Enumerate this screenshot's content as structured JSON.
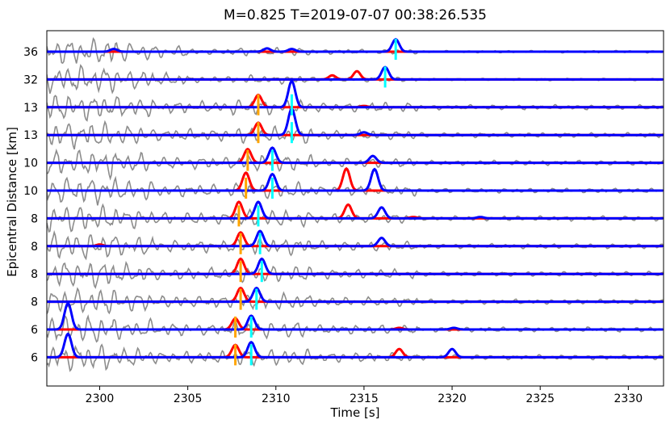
{
  "chart_data": {
    "type": "line",
    "title": "M=0.825  T=2019-07-07 00:38:26.535",
    "xlabel": "Time [s]",
    "ylabel": "Epicentral Distance [km]",
    "xlim": [
      2297,
      2332
    ],
    "xticks": [
      2300,
      2305,
      2310,
      2315,
      2320,
      2325,
      2330
    ],
    "colors": {
      "waveform": "#7f7f7f",
      "p_prob": "#ff0000",
      "s_prob": "#0000ff",
      "p_pick": "#ffa500",
      "s_pick": "#00ffff"
    },
    "traces": [
      {
        "distance": "36",
        "p_peaks": [],
        "s_peaks": [
          {
            "t": 2300.8,
            "a": 0.1
          },
          {
            "t": 2309.5,
            "a": 0.12
          },
          {
            "t": 2310.9,
            "a": 0.1
          },
          {
            "t": 2316.8,
            "a": 0.45
          }
        ],
        "p_pick": null,
        "s_pick": 2316.8
      },
      {
        "distance": "32",
        "p_peaks": [
          {
            "t": 2313.2,
            "a": 0.15
          },
          {
            "t": 2314.6,
            "a": 0.3
          }
        ],
        "s_peaks": [
          {
            "t": 2316.2,
            "a": 0.45
          }
        ],
        "p_pick": null,
        "s_pick": 2316.2
      },
      {
        "distance": "13",
        "p_peaks": [
          {
            "t": 2309.0,
            "a": 0.45
          },
          {
            "t": 2315.0,
            "a": 0.05
          }
        ],
        "s_peaks": [
          {
            "t": 2310.9,
            "a": 0.95
          }
        ],
        "p_pick": 2309.0,
        "s_pick": 2310.9
      },
      {
        "distance": "13",
        "p_peaks": [
          {
            "t": 2309.0,
            "a": 0.45
          }
        ],
        "s_peaks": [
          {
            "t": 2310.9,
            "a": 0.95
          },
          {
            "t": 2315.0,
            "a": 0.1
          }
        ],
        "p_pick": 2309.0,
        "s_pick": 2310.9
      },
      {
        "distance": "10",
        "p_peaks": [
          {
            "t": 2308.4,
            "a": 0.5
          }
        ],
        "s_peaks": [
          {
            "t": 2309.8,
            "a": 0.55
          },
          {
            "t": 2315.5,
            "a": 0.25
          }
        ],
        "p_pick": 2308.4,
        "s_pick": 2309.8
      },
      {
        "distance": "10",
        "p_peaks": [
          {
            "t": 2308.3,
            "a": 0.65
          },
          {
            "t": 2314.0,
            "a": 0.8
          }
        ],
        "s_peaks": [
          {
            "t": 2309.8,
            "a": 0.6
          },
          {
            "t": 2315.6,
            "a": 0.78
          }
        ],
        "p_pick": 2308.3,
        "s_pick": 2309.8
      },
      {
        "distance": "8",
        "p_peaks": [
          {
            "t": 2307.9,
            "a": 0.6
          },
          {
            "t": 2314.1,
            "a": 0.5
          },
          {
            "t": 2317.8,
            "a": 0.05
          }
        ],
        "s_peaks": [
          {
            "t": 2309.0,
            "a": 0.6
          },
          {
            "t": 2316.0,
            "a": 0.4
          },
          {
            "t": 2321.6,
            "a": 0.05
          }
        ],
        "p_pick": 2307.9,
        "s_pick": 2309.0
      },
      {
        "distance": "8",
        "p_peaks": [
          {
            "t": 2300.0,
            "a": 0.06
          },
          {
            "t": 2308.0,
            "a": 0.5
          }
        ],
        "s_peaks": [
          {
            "t": 2309.1,
            "a": 0.55
          },
          {
            "t": 2316.0,
            "a": 0.3
          }
        ],
        "p_pick": 2308.0,
        "s_pick": 2309.1
      },
      {
        "distance": "8",
        "p_peaks": [
          {
            "t": 2308.0,
            "a": 0.55
          }
        ],
        "s_peaks": [
          {
            "t": 2309.2,
            "a": 0.55
          }
        ],
        "p_pick": 2308.0,
        "s_pick": 2309.2
      },
      {
        "distance": "8",
        "p_peaks": [
          {
            "t": 2308.0,
            "a": 0.5
          }
        ],
        "s_peaks": [
          {
            "t": 2308.9,
            "a": 0.5
          }
        ],
        "p_pick": 2308.0,
        "s_pick": 2308.9
      },
      {
        "distance": "6",
        "p_peaks": [
          {
            "t": 2307.7,
            "a": 0.4
          },
          {
            "t": 2317.0,
            "a": 0.06
          }
        ],
        "s_peaks": [
          {
            "t": 2298.2,
            "a": 0.95
          },
          {
            "t": 2308.6,
            "a": 0.5
          },
          {
            "t": 2320.1,
            "a": 0.06
          }
        ],
        "p_pick": 2307.7,
        "s_pick": 2308.6
      },
      {
        "distance": "6",
        "p_peaks": [
          {
            "t": 2307.7,
            "a": 0.45
          },
          {
            "t": 2317.0,
            "a": 0.3
          }
        ],
        "s_peaks": [
          {
            "t": 2298.2,
            "a": 0.85
          },
          {
            "t": 2308.6,
            "a": 0.55
          },
          {
            "t": 2320.0,
            "a": 0.3
          }
        ],
        "p_pick": 2307.7,
        "s_pick": 2308.6
      }
    ]
  }
}
